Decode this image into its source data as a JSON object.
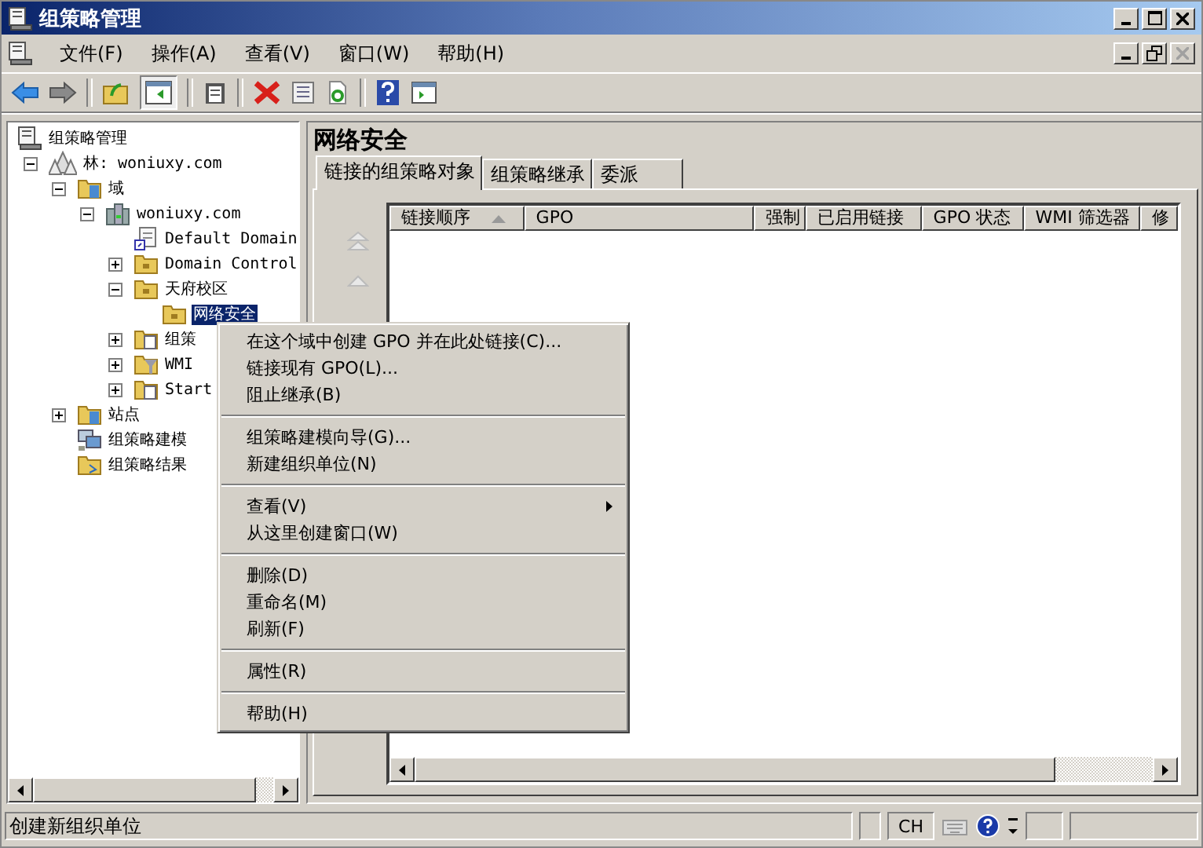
{
  "window": {
    "title": "组策略管理"
  },
  "menu_bar": [
    "文件(F)",
    "操作(A)",
    "查看(V)",
    "窗口(W)",
    "帮助(H)"
  ],
  "tree": [
    {
      "label": "组策略管理",
      "kind": "root",
      "selected": false,
      "children": [
        {
          "label": "林: woniuxy.com",
          "kind": "forest",
          "expanded": true,
          "selected": false,
          "children": [
            {
              "label": "域",
              "kind": "domains",
              "expanded": true,
              "selected": false,
              "children": [
                {
                  "label": "woniuxy.com",
                  "kind": "domain",
                  "expanded": true,
                  "selected": false,
                  "children": [
                    {
                      "label": "Default Domain",
                      "kind": "gpo",
                      "selected": false
                    },
                    {
                      "label": "Domain Control",
                      "kind": "ou",
                      "expanded": false,
                      "selected": false
                    },
                    {
                      "label": "天府校区",
                      "kind": "ou",
                      "expanded": true,
                      "selected": false,
                      "children": [
                        {
                          "label": "网络安全",
                          "kind": "ou",
                          "selected": true
                        }
                      ]
                    },
                    {
                      "label": "组策",
                      "kind": "gpo-folder",
                      "expanded": false,
                      "selected": false
                    },
                    {
                      "label": "WMI",
                      "kind": "wmi-folder",
                      "expanded": false,
                      "selected": false
                    },
                    {
                      "label": "Start",
                      "kind": "starter-folder",
                      "expanded": false,
                      "selected": false
                    }
                  ]
                }
              ]
            },
            {
              "label": "站点",
              "kind": "sites",
              "expanded": false,
              "selected": false
            },
            {
              "label": "组策略建模",
              "kind": "modeling",
              "selected": false
            },
            {
              "label": "组策略结果",
              "kind": "results",
              "selected": false
            }
          ]
        }
      ]
    }
  ],
  "details": {
    "title": "网络安全",
    "tabs": [
      {
        "label": "链接的组策略对象",
        "selected": true
      },
      {
        "label": "组策略继承",
        "selected": false
      },
      {
        "label": "委派",
        "selected": false
      }
    ],
    "columns": [
      {
        "label": "链接顺序",
        "sorted": true
      },
      {
        "label": "GPO",
        "sorted": false
      },
      {
        "label": "强制",
        "sorted": false
      },
      {
        "label": "已启用链接",
        "sorted": false
      },
      {
        "label": "GPO 状态",
        "sorted": false
      },
      {
        "label": "WMI 筛选器",
        "sorted": false
      },
      {
        "label": "修",
        "sorted": false
      }
    ]
  },
  "context_menu": [
    [
      {
        "label": "在这个域中创建 GPO 并在此处链接(C)...",
        "submenu": false
      },
      {
        "label": "链接现有 GPO(L)...",
        "submenu": false
      },
      {
        "label": "阻止继承(B)",
        "submenu": false
      }
    ],
    [
      {
        "label": "组策略建模向导(G)...",
        "submenu": false
      },
      {
        "label": "新建组织单位(N)",
        "submenu": false
      }
    ],
    [
      {
        "label": "查看(V)",
        "submenu": true
      },
      {
        "label": "从这里创建窗口(W)",
        "submenu": false
      }
    ],
    [
      {
        "label": "删除(D)",
        "submenu": false
      },
      {
        "label": "重命名(M)",
        "submenu": false
      },
      {
        "label": "刷新(F)",
        "submenu": false
      }
    ],
    [
      {
        "label": "属性(R)",
        "submenu": false
      }
    ],
    [
      {
        "label": "帮助(H)",
        "submenu": false
      }
    ]
  ],
  "status_bar": {
    "message": "创建新组织单位",
    "input_language": "CH"
  }
}
